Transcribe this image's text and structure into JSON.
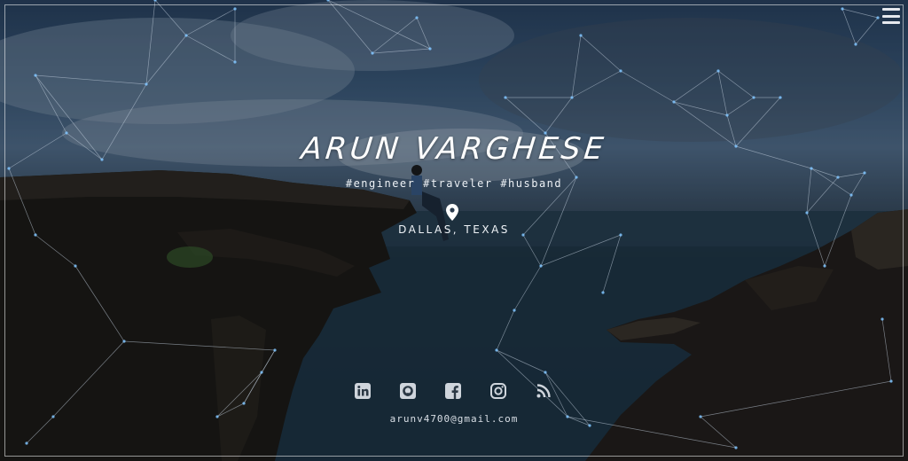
{
  "profile": {
    "name": "ARUN VARGHESE",
    "tagline": "#engineer #traveler #husband",
    "location": "DALLAS, TEXAS",
    "email": "arunv4700@gmail.com"
  },
  "icons": {
    "menu": "hamburger-menu-icon",
    "location": "map-pin-icon",
    "social": [
      "linkedin-icon",
      "github-icon",
      "facebook-icon",
      "instagram-icon",
      "rss-icon"
    ]
  },
  "colors": {
    "text": "#ffffff",
    "network_lines": "#c9d6e4",
    "network_nodes": "#7fc4ff",
    "sky": "#3c5a7a",
    "sea": "#1d3140",
    "cliff": "#1a1612"
  }
}
